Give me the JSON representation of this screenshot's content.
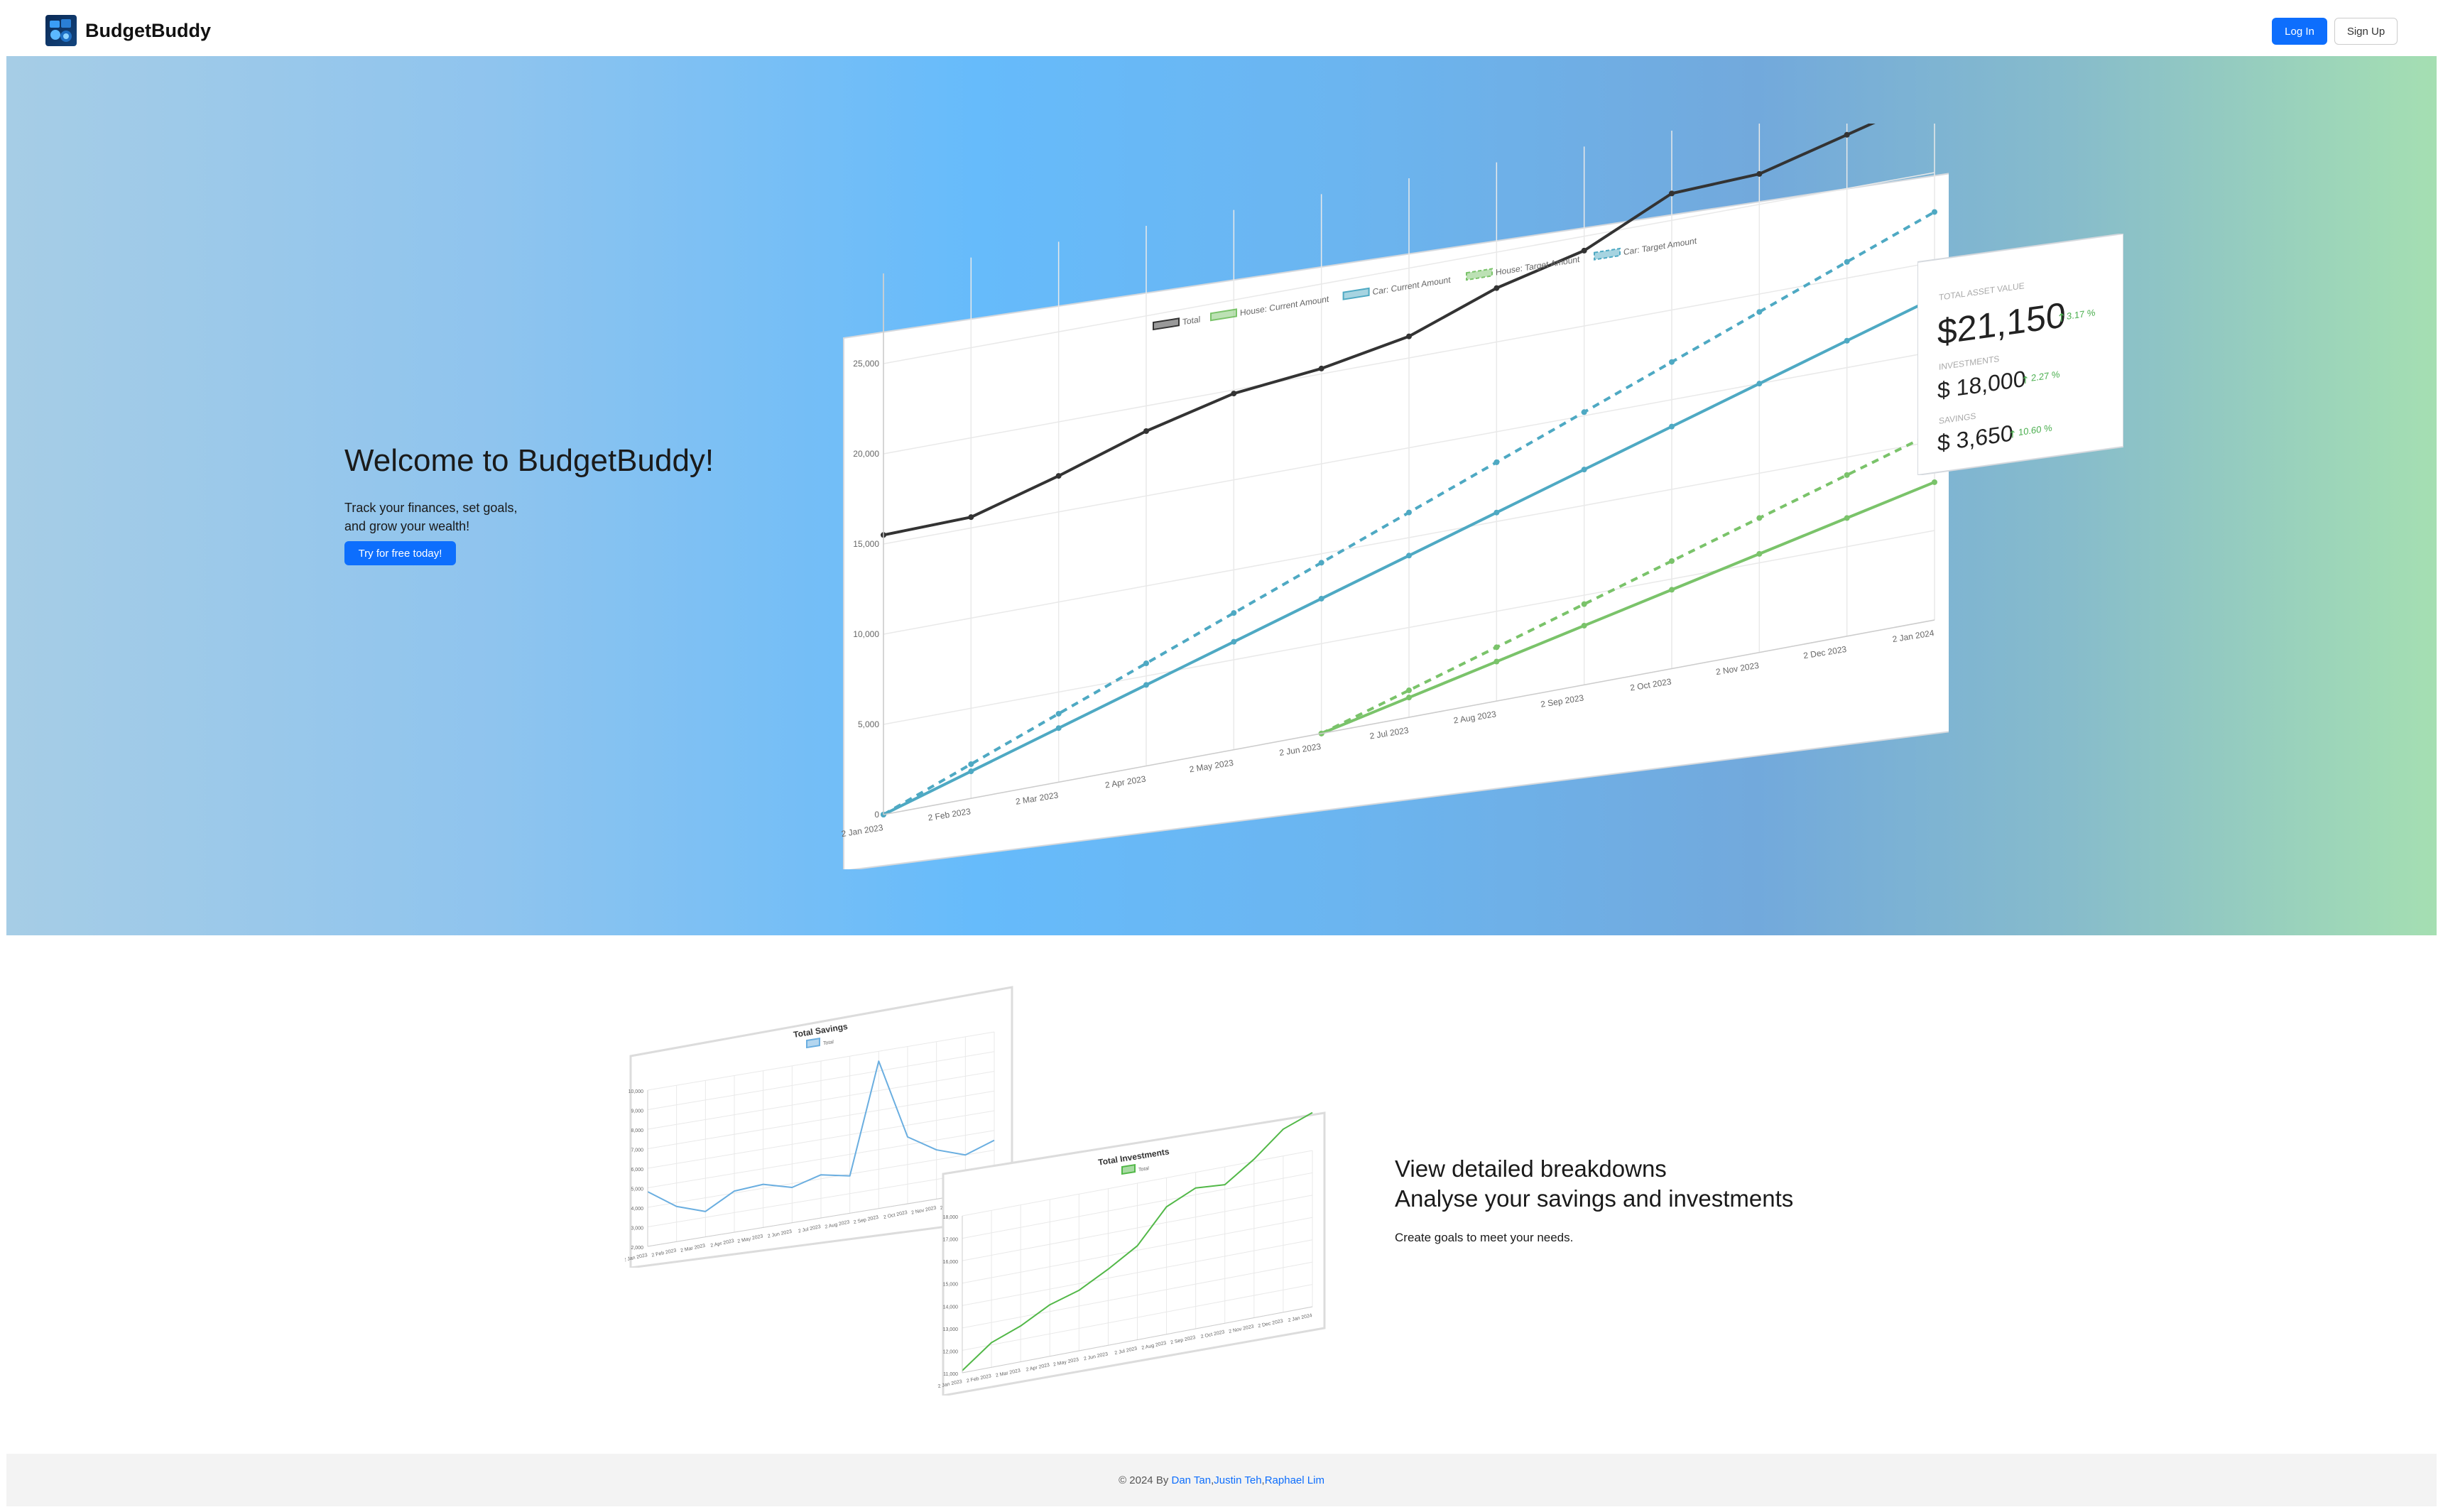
{
  "nav": {
    "brand": "BudgetBuddy",
    "login_label": "Log In",
    "signup_label": "Sign Up",
    "logo_icon": "budgetbuddy-logo-icon"
  },
  "hero": {
    "title": "Welcome to BudgetBuddy!",
    "subtitle_line1": "Track your finances, set goals,",
    "subtitle_line2": "and grow your wealth!",
    "cta_label": "Try for free today!"
  },
  "stats": {
    "total_label": "TOTAL ASSET VALUE",
    "total_value": "$21,150",
    "total_change": "3.17 %",
    "investments_label": "INVESTMENTS",
    "investments_value": "$ 18,000",
    "investments_change": "2.27 %",
    "savings_label": "SAVINGS",
    "savings_value": "$ 3,650",
    "savings_change": "10.60 %",
    "up_color": "#4caf50"
  },
  "chart_data": [
    {
      "type": "line",
      "title": "",
      "x": [
        "2 Jan 2023",
        "2 Feb 2023",
        "2 Mar 2023",
        "2 Apr 2023",
        "2 May 2023",
        "2 Jun 2023",
        "2 Jul 2023",
        "2 Aug 2023",
        "2 Sep 2023",
        "2 Oct 2023",
        "2 Nov 2023",
        "2 Dec 2023",
        "2 Jan 2024"
      ],
      "ylim": [
        0,
        25000
      ],
      "yticks": [
        "0",
        "5,000",
        "10,000",
        "15,000",
        "20,000",
        "25,000"
      ],
      "legend": "top",
      "series": [
        {
          "name": "Total",
          "color": "#333333",
          "dashed": false,
          "values": [
            15500,
            15600,
            17000,
            18600,
            19800,
            20300,
            21200,
            23000,
            24200,
            26500,
            26700,
            28000,
            29300
          ]
        },
        {
          "name": "House: Current Amount",
          "color": "#7ac36a",
          "dashed": false,
          "values": [
            null,
            null,
            null,
            null,
            null,
            0,
            1100,
            2200,
            3300,
            4400,
            5500,
            6600,
            7700
          ]
        },
        {
          "name": "Car: Current Amount",
          "color": "#4ea9c3",
          "dashed": false,
          "values": [
            0,
            1500,
            3000,
            4500,
            6000,
            7500,
            9000,
            10500,
            12000,
            13500,
            15000,
            16500,
            18000
          ]
        },
        {
          "name": "House: Target Amount",
          "color": "#7ac36a",
          "dashed": true,
          "values": [
            null,
            null,
            null,
            null,
            null,
            0,
            1500,
            3000,
            4500,
            6000,
            7500,
            9000,
            10500
          ]
        },
        {
          "name": "Car: Target Amount",
          "color": "#4ea9c3",
          "dashed": true,
          "values": [
            0,
            1900,
            3800,
            5700,
            7600,
            9500,
            11400,
            13300,
            15200,
            17100,
            19000,
            20900,
            22800
          ]
        }
      ]
    },
    {
      "type": "line",
      "title": "Total Savings",
      "x": [
        "2 Jan 2023",
        "2 Feb 2023",
        "2 Mar 2023",
        "2 Apr 2023",
        "2 May 2023",
        "2 Jun 2023",
        "2 Jul 2023",
        "2 Aug 2023",
        "2 Sep 2023",
        "2 Oct 2023",
        "2 Nov 2023",
        "2 Dec 2023",
        "2 Jan 2024"
      ],
      "ylim": [
        2000,
        10000
      ],
      "yticks": [
        "2,000",
        "3,000",
        "4,000",
        "5,000",
        "6,000",
        "7,000",
        "8,000",
        "9,000",
        "10,000"
      ],
      "series": [
        {
          "name": "Total",
          "color": "#6aaee0",
          "values": [
            4800,
            3800,
            3300,
            4100,
            4200,
            3800,
            4200,
            3900,
            9500,
            5400,
            4500,
            4000,
            4500
          ]
        }
      ]
    },
    {
      "type": "line",
      "title": "Total Investments",
      "x": [
        "2 Jan 2023",
        "2 Feb 2023",
        "2 Mar 2023",
        "2 Apr 2023",
        "2 May 2023",
        "2 Jun 2023",
        "2 Jul 2023",
        "2 Aug 2023",
        "2 Sep 2023",
        "2 Oct 2023",
        "2 Nov 2023",
        "2 Dec 2023",
        "2 Jan 2024"
      ],
      "ylim": [
        11000,
        18000
      ],
      "yticks": [
        "11,000",
        "12,000",
        "13,000",
        "14,000",
        "15,000",
        "16,000",
        "17,000",
        "18,000"
      ],
      "series": [
        {
          "name": "Total",
          "color": "#52b848",
          "values": [
            11100,
            12100,
            12600,
            13300,
            13700,
            14400,
            15200,
            16700,
            17300,
            17200,
            18100,
            19200,
            19700
          ]
        }
      ]
    }
  ],
  "feature": {
    "title_line1": "View detailed breakdowns",
    "title_line2": "Analyse your savings and investments",
    "subtitle": "Create goals to meet your needs."
  },
  "footer": {
    "prefix": "© 2024 By",
    "author1": "Dan Tan",
    "author2": "Justin Teh",
    "author3": "Raphael Lim",
    "sep": ", "
  }
}
